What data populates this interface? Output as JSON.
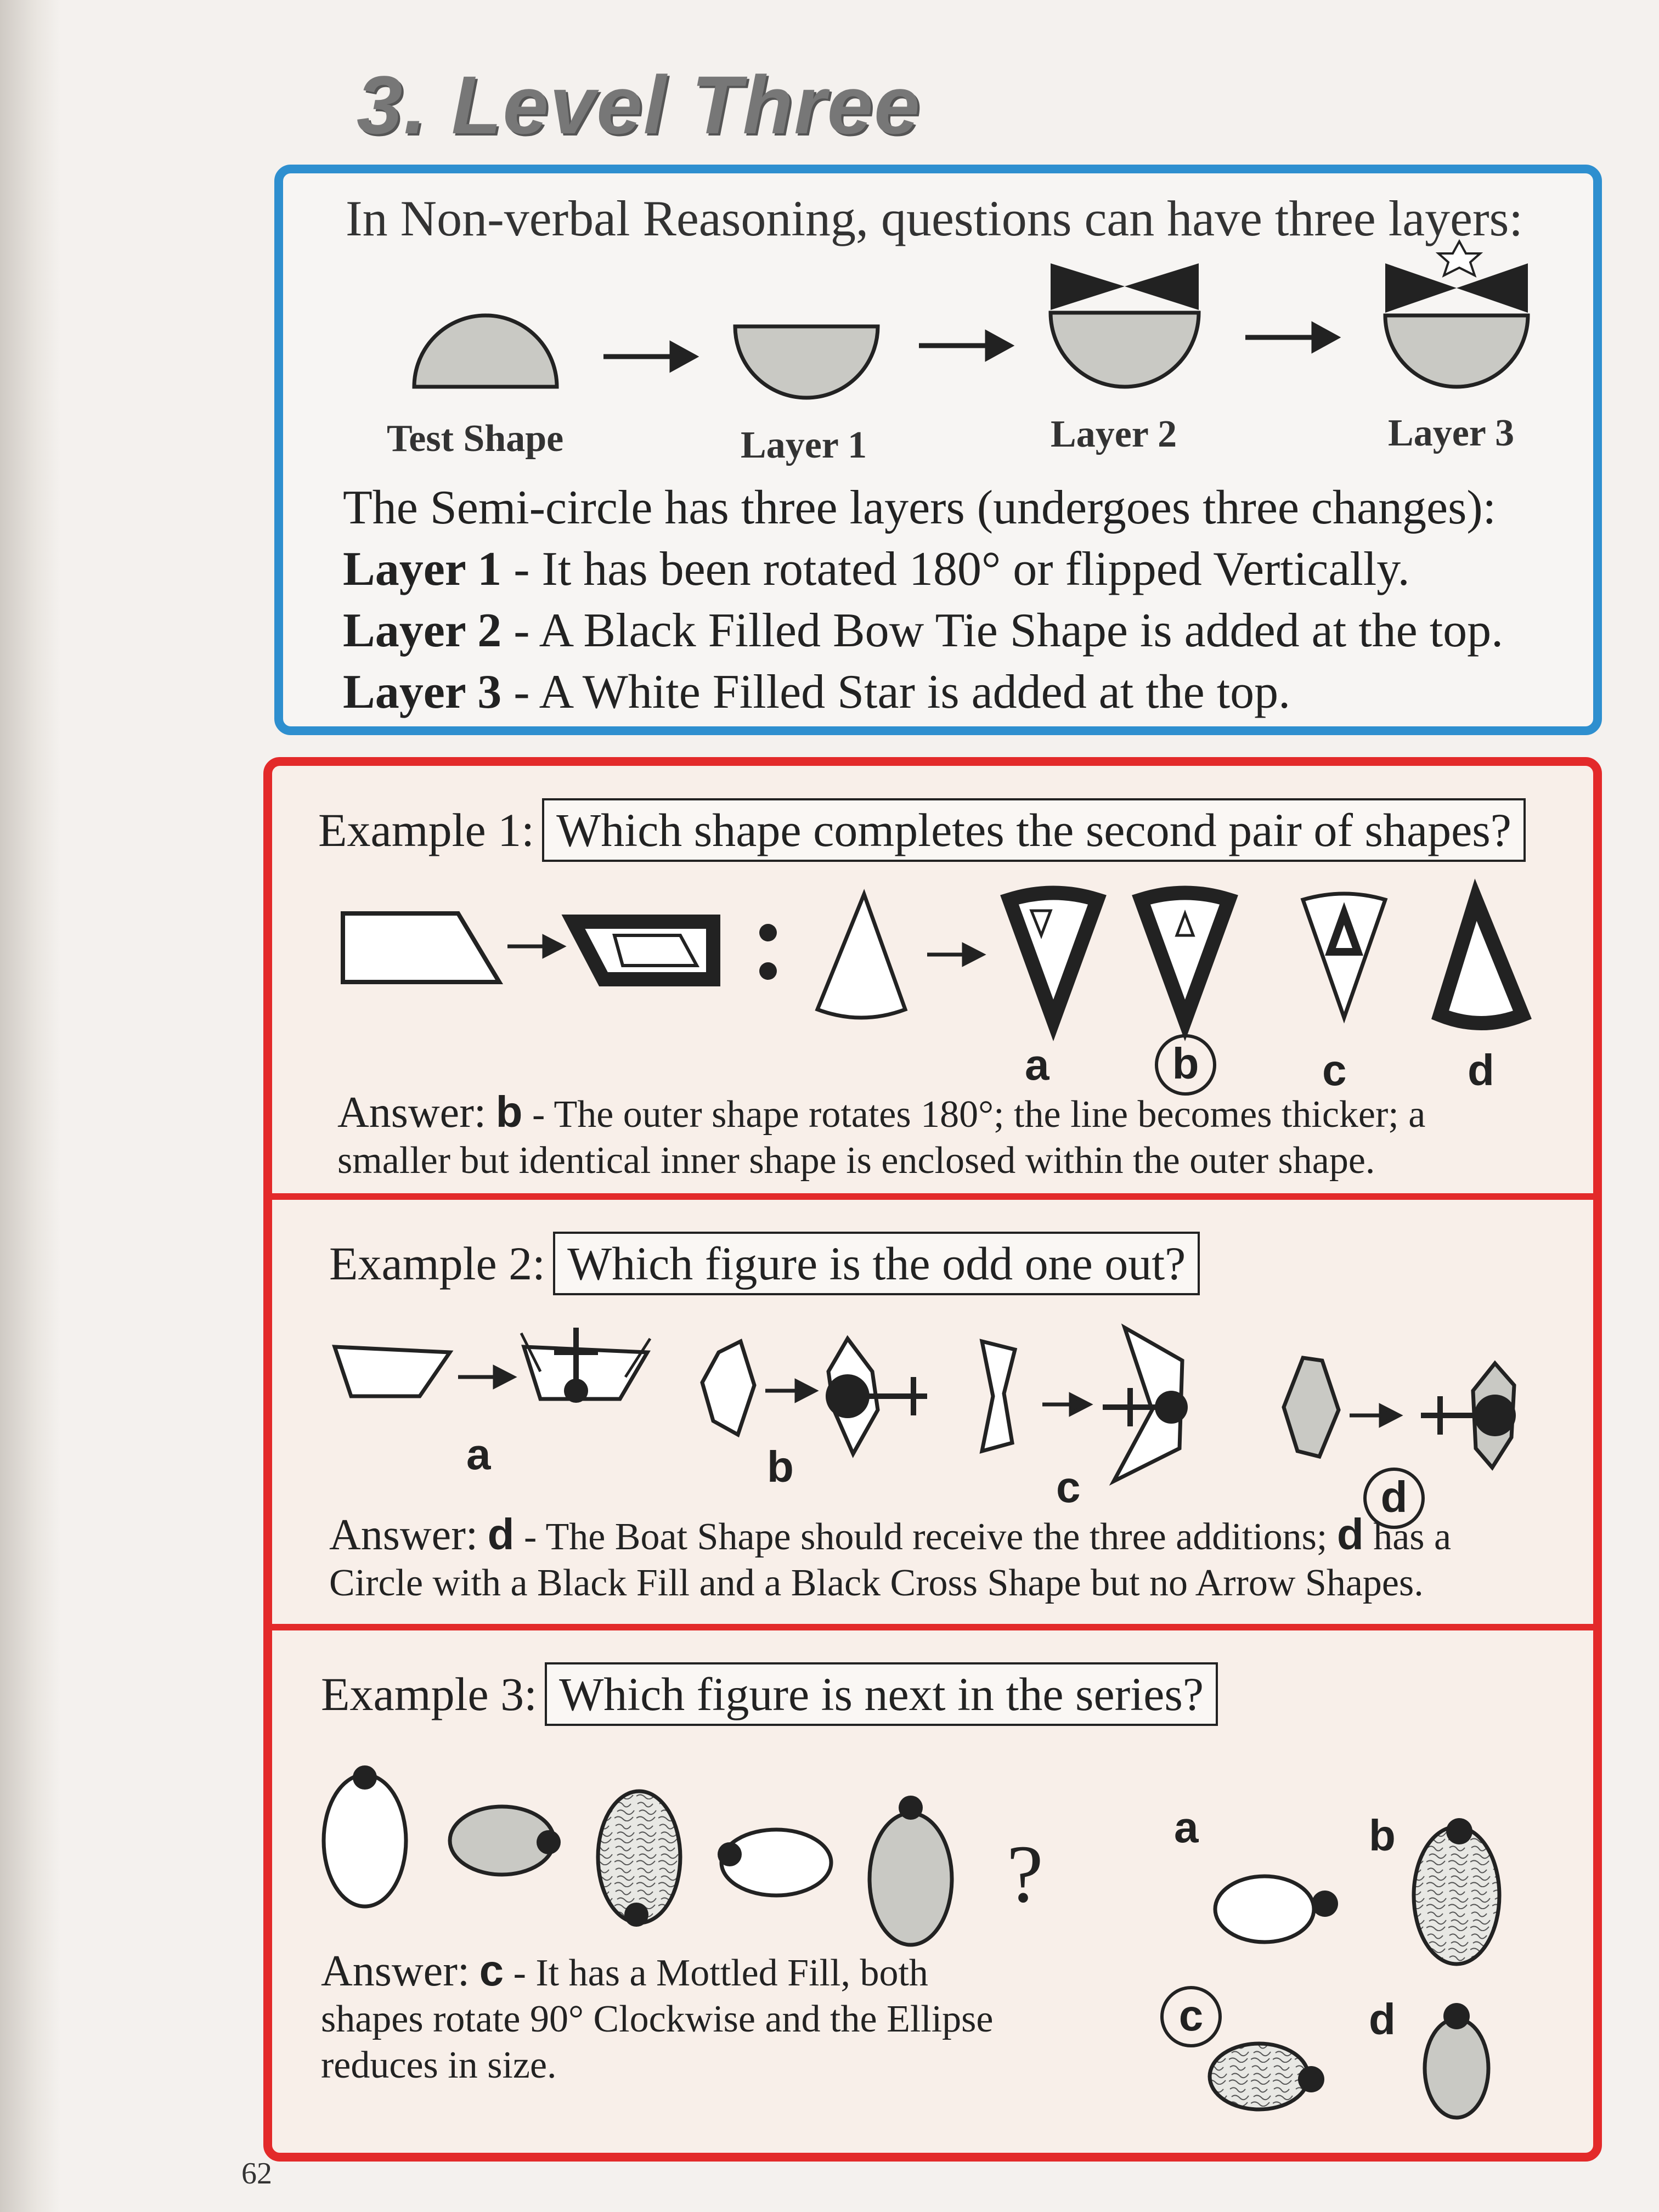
{
  "heading": "3. Level Three",
  "intro": "In Non-verbal Reasoning, questions can have three layers:",
  "layer_labels": [
    "Test Shape",
    "Layer 1",
    "Layer 2",
    "Layer 3"
  ],
  "description": {
    "line1": "The Semi-circle has three layers (undergoes three changes):",
    "items": [
      {
        "label": "Layer 1",
        "text": " - It has been rotated 180° or flipped Vertically."
      },
      {
        "label": "Layer 2",
        "text": " - A Black Filled Bow Tie Shape is added at the top."
      },
      {
        "label": "Layer 3",
        "text": " - A White Filled Star is added at the top."
      }
    ]
  },
  "examples": [
    {
      "title": "Example 1:",
      "question": "Which shape completes the second pair of shapes?",
      "options": [
        "a",
        "b",
        "c",
        "d"
      ],
      "answer_prefix": "Answer:",
      "answer_letter": "b",
      "answer_text": " - The outer shape rotates 180°; the line becomes thicker; a",
      "answer_text2": "smaller but identical inner shape is enclosed within the outer shape."
    },
    {
      "title": "Example 2:",
      "question": "Which figure is the odd one out?",
      "options": [
        "a",
        "b",
        "c",
        "d"
      ],
      "answer_prefix": "Answer:",
      "answer_letter": "d",
      "answer_text": " - The Boat Shape should receive the three additions; ",
      "answer_letter2": "d",
      "answer_text_b": " has a",
      "answer_text2": "Circle with a Black Fill and a Black Cross Shape but no Arrow Shapes."
    },
    {
      "title": "Example 3:",
      "question": "Which figure is next in the series?",
      "question_mark": "?",
      "options": [
        "a",
        "b",
        "c",
        "d"
      ],
      "answer_prefix": "Answer:",
      "answer_letter": "c",
      "answer_text": " - It has a Mottled Fill, both",
      "answer_text2": "shapes rotate 90° Clockwise and the Ellipse",
      "answer_text3": "reduces in size."
    }
  ],
  "page_number": "62",
  "colors": {
    "blue_border": "#2e8fcf",
    "red_border": "#e32a2a",
    "grey_fill": "#c9c9c4"
  }
}
